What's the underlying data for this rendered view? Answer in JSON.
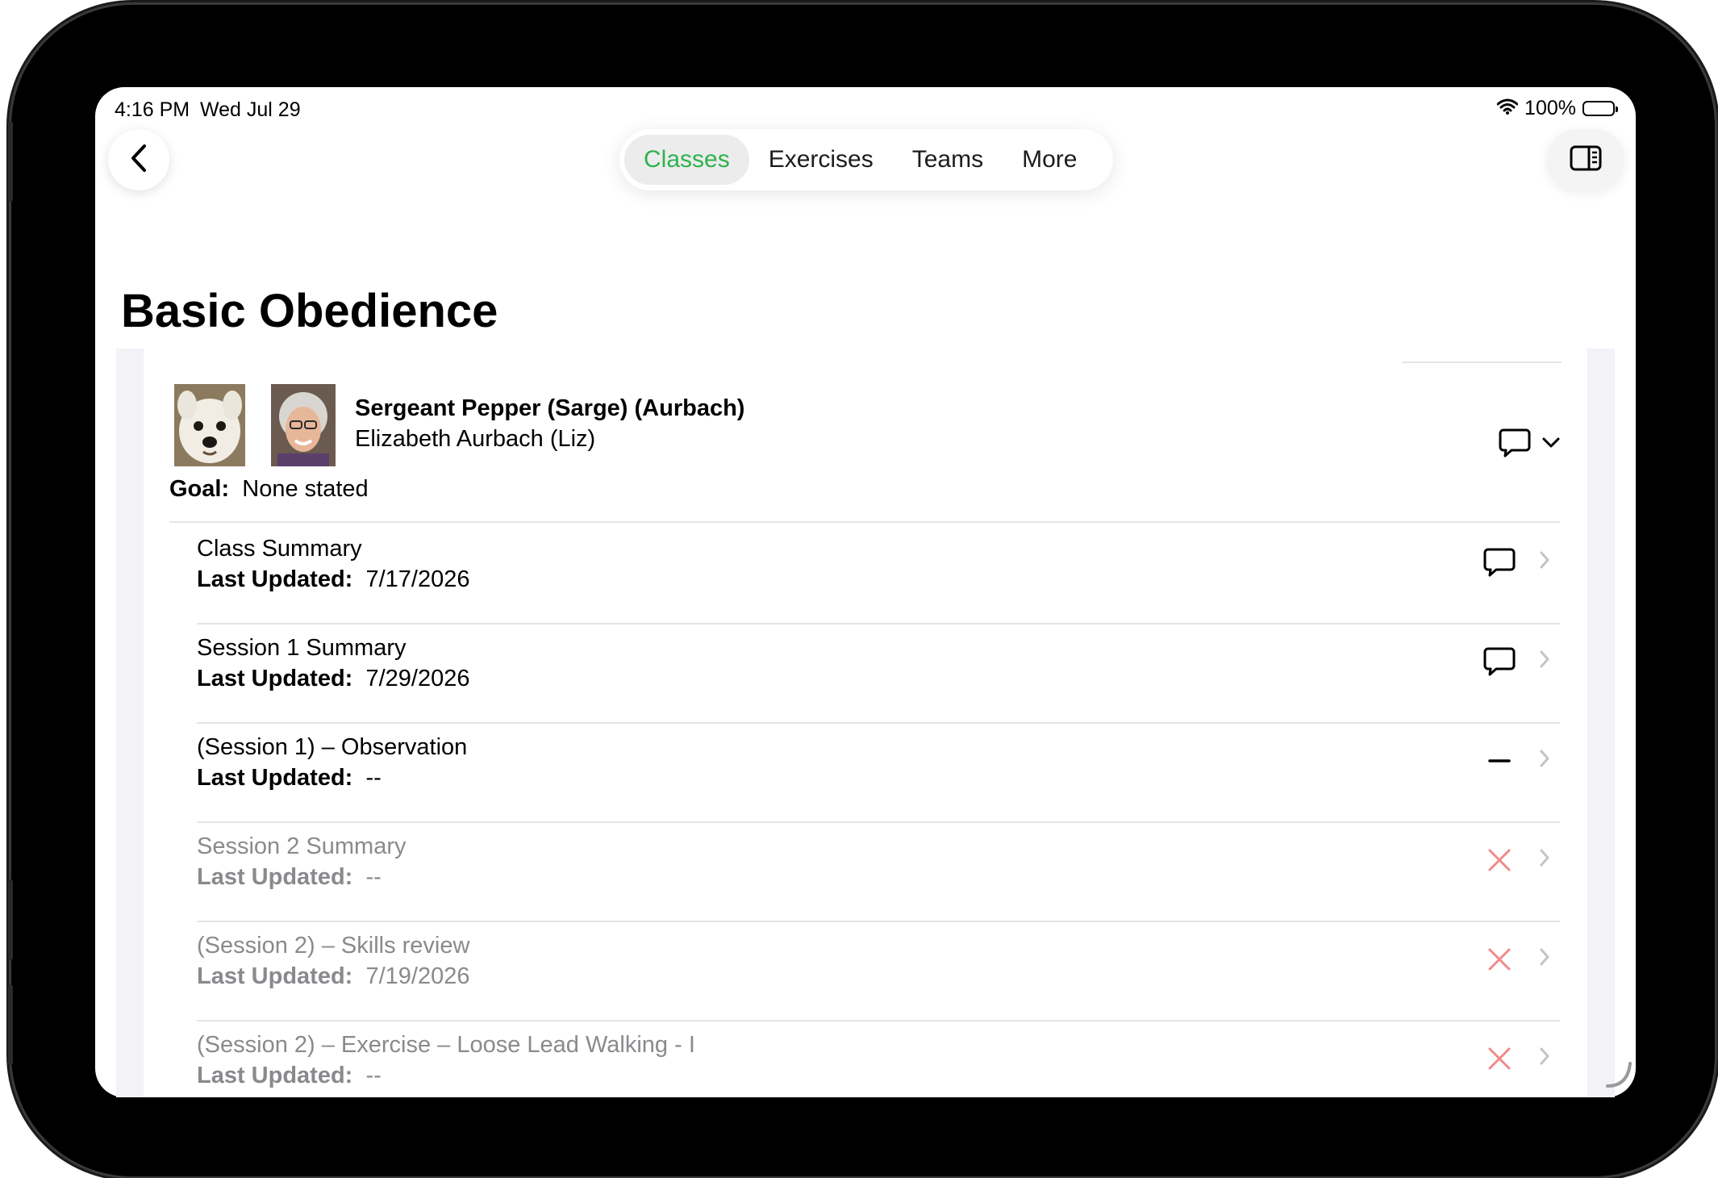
{
  "status_bar": {
    "time": "4:16 PM",
    "date": "Wed Jul 29",
    "battery": "100%"
  },
  "nav": {
    "back_icon": "chevron-left-icon",
    "tabs": [
      {
        "label": "Classes",
        "active": true
      },
      {
        "label": "Exercises",
        "active": false
      },
      {
        "label": "Teams",
        "active": false
      },
      {
        "label": "More",
        "active": false
      }
    ],
    "sidebar_icon": "sidebar-toggle-icon"
  },
  "page": {
    "title": "Basic Obedience"
  },
  "team": {
    "pet_name": "Sergeant Pepper (Sarge) (Aurbach)",
    "owner_name": "Elizabeth Aurbach  (Liz)",
    "goal_label": "Goal:",
    "goal_value": "None stated"
  },
  "rows": [
    {
      "title": "Class Summary",
      "updated_label": "Last Updated:",
      "updated_value": "7/17/2026",
      "status": "comment",
      "dimmed": false
    },
    {
      "title": "Session 1 Summary",
      "updated_label": "Last Updated:",
      "updated_value": "7/29/2026",
      "status": "comment",
      "dimmed": false
    },
    {
      "title": " (Session 1) – Observation",
      "updated_label": "Last Updated:",
      "updated_value": "--",
      "status": "dash",
      "dimmed": false
    },
    {
      "title": "Session 2 Summary",
      "updated_label": "Last Updated:",
      "updated_value": "--",
      "status": "x",
      "dimmed": true
    },
    {
      "title": " (Session 2) – Skills review",
      "updated_label": "Last Updated:",
      "updated_value": "7/19/2026",
      "status": "x",
      "dimmed": true
    },
    {
      "title": " (Session 2) – Exercise – Loose Lead Walking - I",
      "updated_label": "Last Updated:",
      "updated_value": "--",
      "status": "x",
      "dimmed": true
    }
  ],
  "colors": {
    "accent": "#2fb24c",
    "error": "#f08a8a",
    "muted": "#8a8a8e"
  }
}
